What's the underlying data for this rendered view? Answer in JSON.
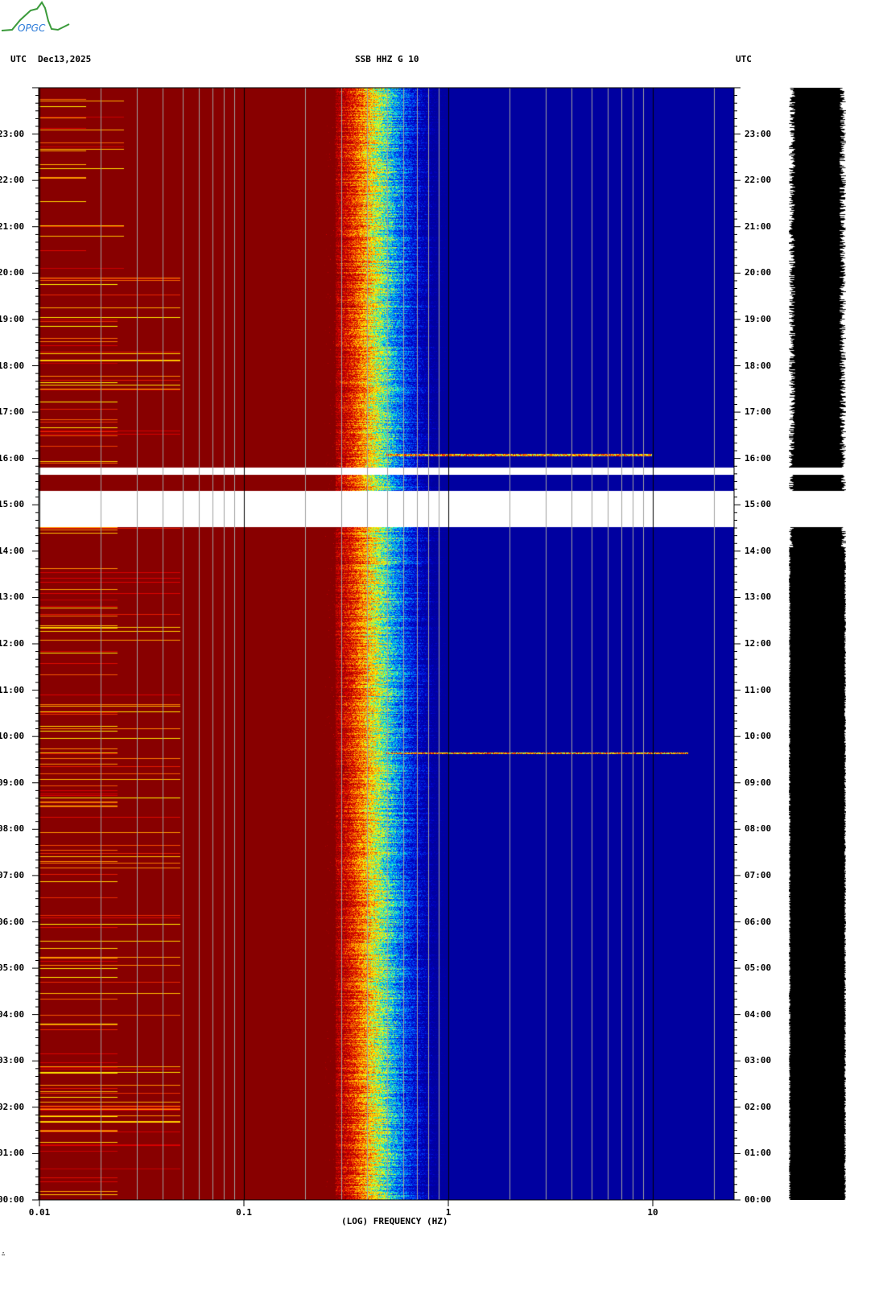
{
  "header": {
    "left_tz": "UTC",
    "date": "Dec13,2025",
    "station": "SSB HHZ G 10",
    "right_tz": "UTC"
  },
  "logo": {
    "text": "OPGC"
  },
  "footer_mark": "∴",
  "colors": {
    "low": "#880000",
    "high": "#0000a0",
    "gap": "#ffffff",
    "grid": "#a0a0a0"
  },
  "chart_data": {
    "type": "heatmap",
    "title": "SSB HHZ G 10",
    "xlabel": "(LOG) FREQUENCY (HZ)",
    "xscale": "log",
    "xlim": [
      0.01,
      25
    ],
    "x_ticks": [
      {
        "v": 0.01,
        "label": "0.01"
      },
      {
        "v": 0.1,
        "label": "0.1"
      },
      {
        "v": 1,
        "label": "1"
      },
      {
        "v": 10,
        "label": "10"
      }
    ],
    "ylabel": "UTC",
    "ylim_hours": [
      0,
      24
    ],
    "y_ticks": [
      "00:00",
      "01:00",
      "02:00",
      "03:00",
      "04:00",
      "05:00",
      "06:00",
      "07:00",
      "08:00",
      "09:00",
      "10:00",
      "11:00",
      "12:00",
      "13:00",
      "14:00",
      "15:00",
      "16:00",
      "17:00",
      "18:00",
      "19:00",
      "20:00",
      "21:00",
      "22:00",
      "23:00"
    ],
    "data_gaps_hours": [
      [
        14.52,
        15.3
      ],
      [
        15.65,
        15.81
      ]
    ],
    "peak_band_hz": [
      0.3,
      0.7
    ],
    "events": [
      {
        "hour": 16.08,
        "fmax_hz": 10
      },
      {
        "hour": 9.65,
        "fmax_hz": 15
      }
    ]
  }
}
